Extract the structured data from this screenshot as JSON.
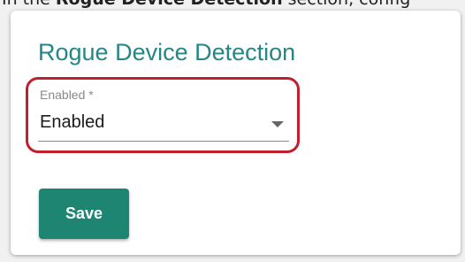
{
  "instruction": {
    "prefix": "In the ",
    "bold_text": "Rogue Device Detection",
    "suffix": " section, config"
  },
  "card": {
    "title": "Rogue Device Detection"
  },
  "enabled_field": {
    "label": "Enabled *",
    "value": "Enabled",
    "icon": "dropdown-arrow-icon"
  },
  "actions": {
    "save_label": "Save"
  },
  "colors": {
    "title": "#23878a",
    "save_button": "#1e8573",
    "highlight_border": "#c0202e"
  }
}
